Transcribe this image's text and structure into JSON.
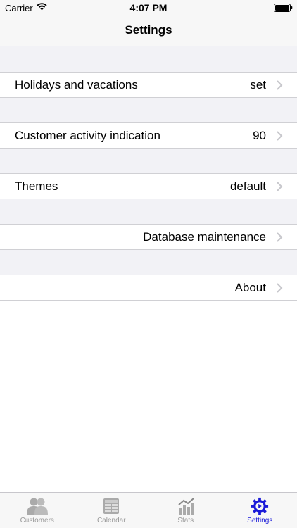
{
  "status_bar": {
    "carrier": "Carrier",
    "time": "4:07 PM"
  },
  "nav": {
    "title": "Settings"
  },
  "rows": [
    {
      "label": "Holidays and vacations",
      "value": "set"
    },
    {
      "label": "Customer activity indication",
      "value": "90"
    },
    {
      "label": "Themes",
      "value": "default"
    },
    {
      "label": "",
      "value": "Database maintenance"
    },
    {
      "label": "",
      "value": "About"
    }
  ],
  "tabs": [
    {
      "label": "Customers",
      "icon": "customers-icon",
      "active": false
    },
    {
      "label": "Calendar",
      "icon": "calendar-icon",
      "active": false
    },
    {
      "label": "Stats",
      "icon": "stats-icon",
      "active": false
    },
    {
      "label": "Settings",
      "icon": "gear-icon",
      "active": true
    }
  ],
  "colors": {
    "accent": "#1a1ad8",
    "inactive": "#999999",
    "chevron": "#c7c7cc"
  }
}
